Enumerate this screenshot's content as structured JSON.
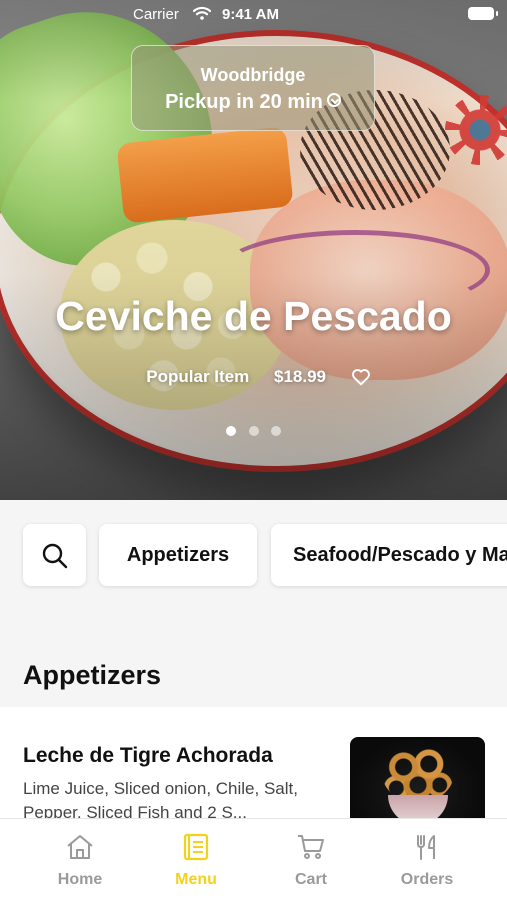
{
  "status_bar": {
    "carrier": "Carrier",
    "time": "9:41 AM"
  },
  "location": {
    "name": "Woodbridge",
    "pickup": "Pickup in 20 min"
  },
  "hero": {
    "title": "Ceviche de Pescado",
    "badge": "Popular Item",
    "price": "$18.99",
    "carousel_pages": 3,
    "active_page": 1
  },
  "categories": {
    "search_icon": "search-icon",
    "items": [
      "Appetizers",
      "Seafood/Pescado y Mariscos"
    ]
  },
  "section": {
    "title": "Appetizers"
  },
  "menu_items": [
    {
      "name": "Leche de Tigre Achorada",
      "description": "Lime Juice, Sliced onion, Chile, Salt, Pepper, Sliced Fish and 2 S..."
    }
  ],
  "tabs": [
    {
      "label": "Home",
      "icon": "home-icon",
      "active": false
    },
    {
      "label": "Menu",
      "icon": "menu-icon",
      "active": true
    },
    {
      "label": "Cart",
      "icon": "cart-icon",
      "active": false
    },
    {
      "label": "Orders",
      "icon": "fork-knife-icon",
      "active": false
    }
  ],
  "colors": {
    "accent": "#f2d21c",
    "inactive": "#9a9a9a",
    "text": "#111111"
  }
}
